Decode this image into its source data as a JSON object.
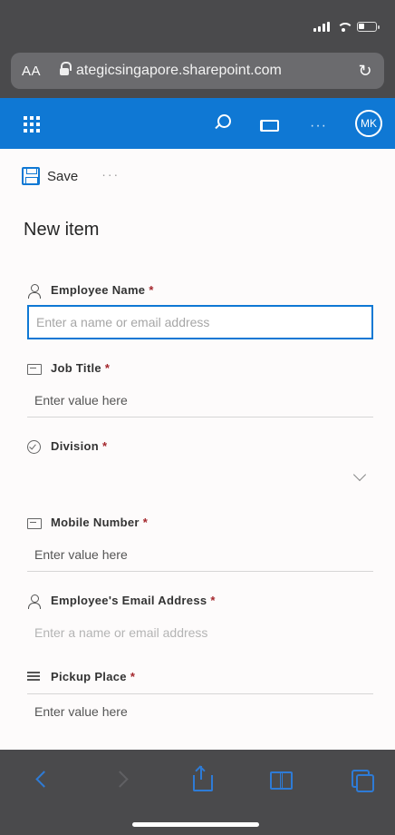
{
  "browser": {
    "text_size_label": "AA",
    "url": "ategicsingapore.sharepoint.com",
    "reload_glyph": "↻"
  },
  "suite_bar": {
    "more_glyph": "···",
    "avatar_initials": "MK",
    "accent_color": "#0f78d4"
  },
  "command_bar": {
    "save_label": "Save",
    "more_glyph": "···"
  },
  "form": {
    "title": "New item",
    "required_mark": "*",
    "fields": [
      {
        "label": "Employee Name",
        "icon": "person-icon",
        "placeholder": "Enter a name or email address"
      },
      {
        "label": "Job Title",
        "icon": "textbox-icon",
        "placeholder": "Enter value here"
      },
      {
        "label": "Division",
        "icon": "choice-icon",
        "value": ""
      },
      {
        "label": "Mobile Number",
        "icon": "textbox-icon",
        "placeholder": "Enter value here"
      },
      {
        "label": "Employee's Email Address",
        "icon": "person-icon",
        "placeholder": "Enter a name or email address"
      },
      {
        "label": "Pickup Place",
        "icon": "lines-icon",
        "placeholder": "Enter value here"
      }
    ]
  }
}
